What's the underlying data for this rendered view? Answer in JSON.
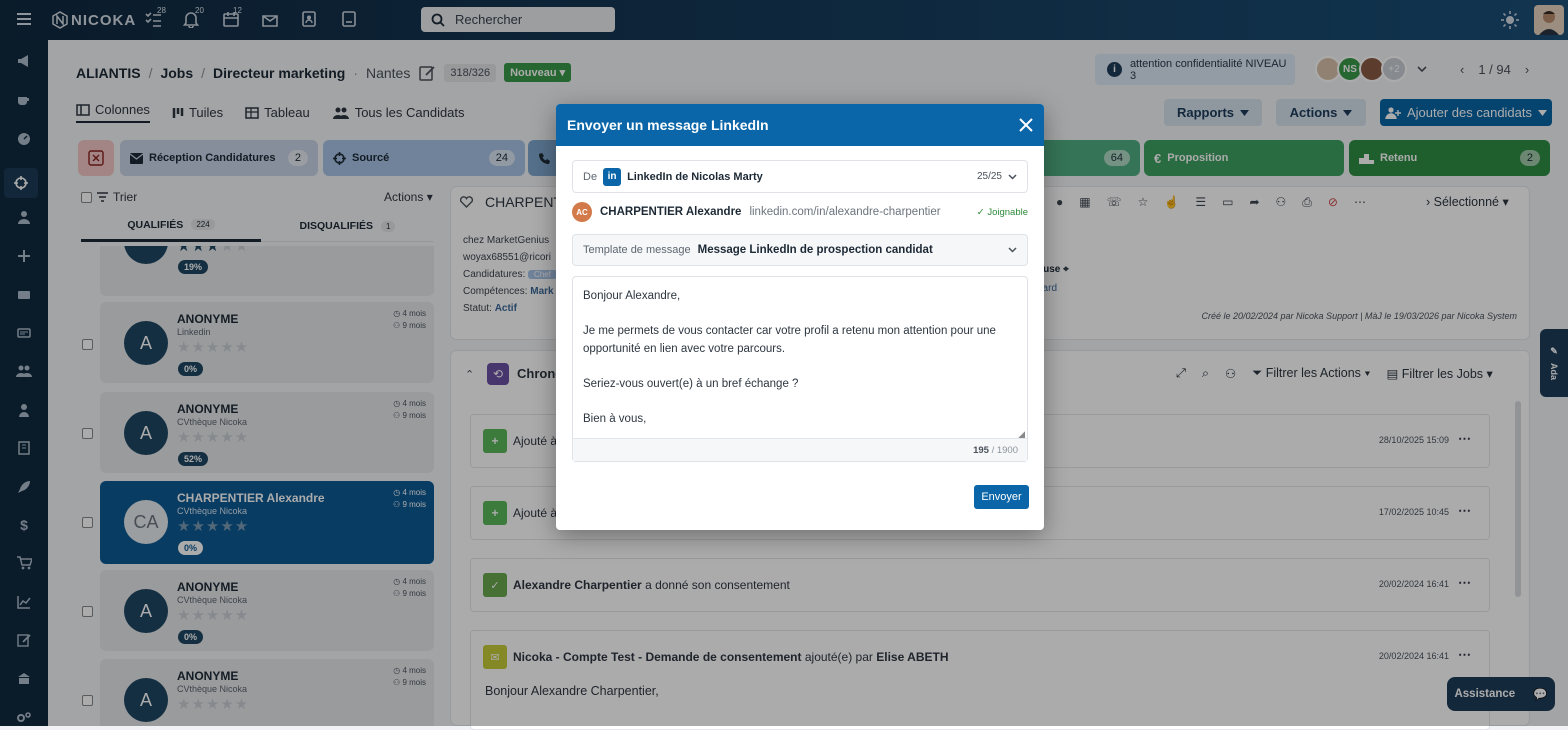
{
  "topbar": {
    "brand": "NICOKA",
    "search_placeholder": "Rechercher",
    "badges": [
      "28",
      "20",
      "12"
    ]
  },
  "header": {
    "breadcrumb": [
      "ALIANTIS",
      "Jobs",
      "Directeur marketing"
    ],
    "city": "Nantes",
    "count": "318/326",
    "status": "Nouveau",
    "alert": "attention confidentialité NIVEAU 3",
    "avatar_initials": "NS",
    "more_avatars": "+2",
    "pagination": "1 / 94"
  },
  "viewtabs": [
    "Colonnes",
    "Tuiles",
    "Tableau",
    "Tous les Candidats"
  ],
  "buttons": {
    "rapports": "Rapports",
    "actions": "Actions",
    "add": "Ajouter des candidats"
  },
  "stages": [
    {
      "label": "Réception Candidatures",
      "count": "2"
    },
    {
      "label": "Sourcé",
      "count": "24"
    },
    {
      "label": "",
      "count": "64"
    },
    {
      "label": "Proposition",
      "count": ""
    },
    {
      "label": "Retenu",
      "count": "2"
    }
  ],
  "list": {
    "sort": "Trier",
    "actions": "Actions",
    "tab_qualified": "QUALIFIÉS",
    "qualified_count": "224",
    "tab_disqualified": "DISQUALIFIÉS",
    "disqualified_count": "1",
    "cards": [
      {
        "initials": "",
        "name": "",
        "source": "",
        "score": "19%",
        "t1": "",
        "t2": ""
      },
      {
        "initials": "A",
        "name": "ANONYME",
        "source": "Linkedin",
        "score": "0%",
        "t1": "4 mois",
        "t2": "9 mois"
      },
      {
        "initials": "A",
        "name": "ANONYME",
        "source": "CVthèque Nicoka",
        "score": "52%",
        "t1": "4 mois",
        "t2": "9 mois"
      },
      {
        "initials": "CA",
        "name": "CHARPENTIER Alexandre",
        "source": "CVthèque Nicoka",
        "score": "0%",
        "t1": "4 mois",
        "t2": "9 mois"
      },
      {
        "initials": "A",
        "name": "ANONYME",
        "source": "CVthèque Nicoka",
        "score": "0%",
        "t1": "4 mois",
        "t2": "9 mois"
      },
      {
        "initials": "A",
        "name": "ANONYME",
        "source": "CVthèque Nicoka",
        "score": "",
        "t1": "4 mois",
        "t2": "9 mois"
      }
    ]
  },
  "detail": {
    "name": "CHARPENT",
    "company": "chez MarketGenius",
    "email": "woyax68551@ricori",
    "candidatures_label": "Candidatures:",
    "competences_label": "Compétences:",
    "competences_value": "Mark",
    "statut_label": "Statut:",
    "statut_value": "Actif",
    "location": "ouse",
    "standard": "dard",
    "selection": "Sélectionné",
    "created": "Créé le 20/02/2024 par Nicoka Support | MàJ le 19/03/2026 par Nicoka System"
  },
  "timeline": {
    "title": "Chrono",
    "filter_actions": "Filtrer les Actions",
    "filter_jobs": "Filtrer les Jobs",
    "events": [
      {
        "text": "Ajouté à",
        "date": "28/10/2025 15:09"
      },
      {
        "text": "Ajouté à",
        "date": "17/02/2025 10:45"
      },
      {
        "bold": "Alexandre Charpentier",
        "text": "a donné son consentement",
        "date": "20/02/2024 16:41"
      },
      {
        "bold": "Nicoka - Compte Test - Demande de consentement",
        "text": "ajouté(e) par",
        "bold2": "Elise ABETH",
        "date": "20/02/2024 16:41",
        "body": "Bonjour Alexandre Charpentier,"
      }
    ]
  },
  "side_tab": "Ada",
  "assistance": "Assistance",
  "modal": {
    "title": "Envoyer un message LinkedIn",
    "from_label": "De",
    "from_value": "LinkedIn de Nicolas Marty",
    "quota": "25/25",
    "recipient_initials": "AC",
    "recipient_name": "CHARPENTIER Alexandre",
    "recipient_url": "linkedin.com/in/alexandre-charpentier",
    "reachable": "Joignable",
    "template_label": "Template de message",
    "template_value": "Message LinkedIn de prospection candidat",
    "message_lines": [
      "Bonjour Alexandre,",
      "",
      "Je me permets de vous contacter car votre profil a retenu mon attention pour une",
      "opportunité en lien avec votre parcours.",
      "",
      "Seriez-vous ouvert(e) à un bref échange ?",
      "",
      "Bien à vous,"
    ],
    "char_count": "195",
    "char_max": "/ 1900",
    "send": "Envoyer"
  },
  "colors": {
    "accent": "#0a66a8",
    "navy": "#10293f",
    "green": "#3a9a4a",
    "sourced": "#a8c3e6"
  }
}
